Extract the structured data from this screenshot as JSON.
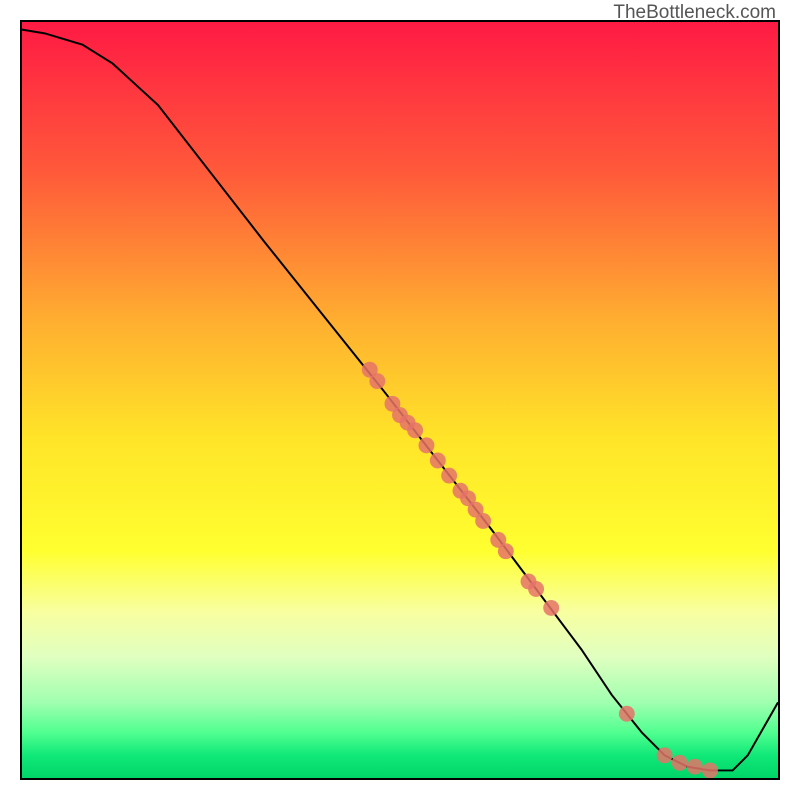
{
  "watermark": "TheBottleneck.com",
  "chart_data": {
    "type": "line",
    "title": "",
    "xlabel": "",
    "ylabel": "",
    "xlim": [
      0,
      100
    ],
    "ylim": [
      0,
      100
    ],
    "gradient_stops": [
      {
        "offset": 0,
        "color": "#ff1a44"
      },
      {
        "offset": 20,
        "color": "#ff5a3a"
      },
      {
        "offset": 40,
        "color": "#ffb030"
      },
      {
        "offset": 55,
        "color": "#ffe428"
      },
      {
        "offset": 70,
        "color": "#ffff30"
      },
      {
        "offset": 78,
        "color": "#f8ffa0"
      },
      {
        "offset": 84,
        "color": "#e0ffc0"
      },
      {
        "offset": 90,
        "color": "#a0ffb0"
      },
      {
        "offset": 94,
        "color": "#50ff90"
      },
      {
        "offset": 97,
        "color": "#10e878"
      },
      {
        "offset": 100,
        "color": "#00d668"
      }
    ],
    "series": [
      {
        "name": "bottleneck-curve",
        "x": [
          0,
          3,
          8,
          12,
          18,
          25,
          32,
          40,
          48,
          55,
          62,
          68,
          74,
          78,
          82,
          85,
          88,
          91,
          94,
          96,
          100
        ],
        "y": [
          99,
          98.5,
          97,
          94.5,
          89,
          80,
          71,
          61,
          51,
          42,
          33,
          25,
          17,
          11,
          6,
          3,
          1.5,
          1,
          1,
          3,
          10
        ]
      }
    ],
    "scatter": {
      "name": "data-points",
      "color": "#e57368",
      "points": [
        {
          "x": 46,
          "y": 54
        },
        {
          "x": 47,
          "y": 52.5
        },
        {
          "x": 49,
          "y": 49.5
        },
        {
          "x": 50,
          "y": 48
        },
        {
          "x": 51,
          "y": 47
        },
        {
          "x": 52,
          "y": 46
        },
        {
          "x": 53.5,
          "y": 44
        },
        {
          "x": 55,
          "y": 42
        },
        {
          "x": 56.5,
          "y": 40
        },
        {
          "x": 58,
          "y": 38
        },
        {
          "x": 59,
          "y": 37
        },
        {
          "x": 60,
          "y": 35.5
        },
        {
          "x": 61,
          "y": 34
        },
        {
          "x": 63,
          "y": 31.5
        },
        {
          "x": 64,
          "y": 30
        },
        {
          "x": 67,
          "y": 26
        },
        {
          "x": 68,
          "y": 25
        },
        {
          "x": 70,
          "y": 22.5
        },
        {
          "x": 80,
          "y": 8.5
        },
        {
          "x": 85,
          "y": 3
        },
        {
          "x": 87,
          "y": 2
        },
        {
          "x": 89,
          "y": 1.5
        },
        {
          "x": 91,
          "y": 1
        }
      ]
    }
  }
}
